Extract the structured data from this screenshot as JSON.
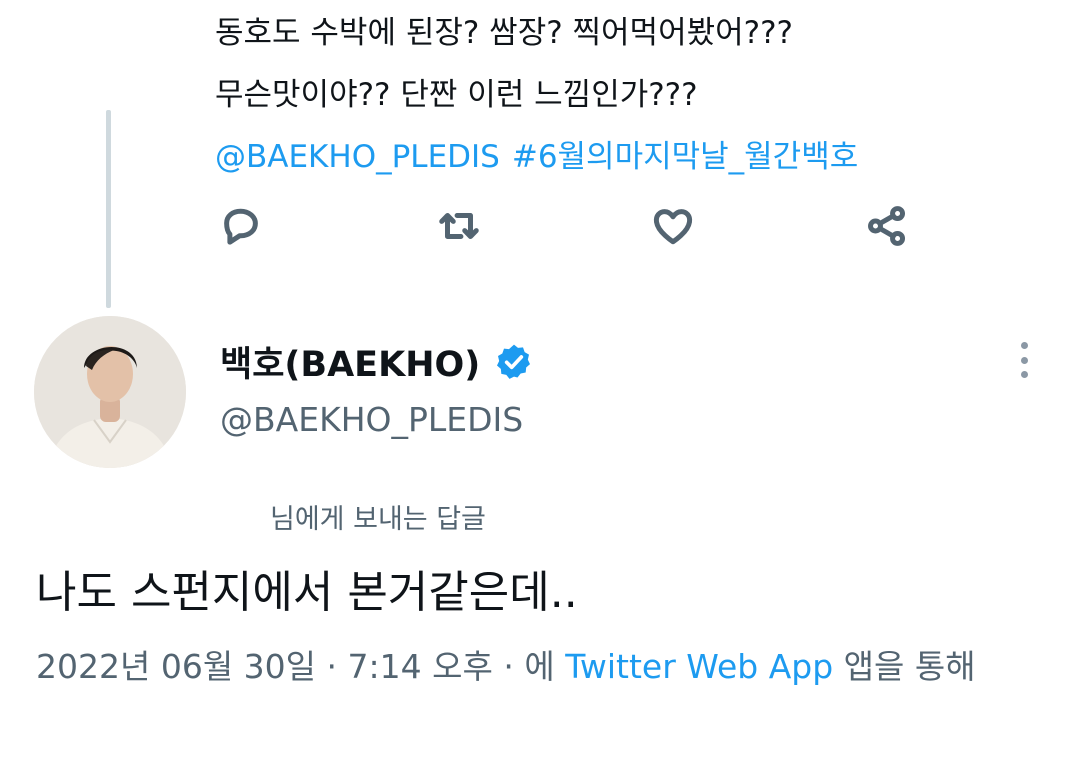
{
  "parent_tweet": {
    "lines": [
      "동호도 수박에 된장? 쌈장? 찍어먹어봤어???",
      "무슨맛이야?? 단짠 이런 느낌인가???"
    ],
    "mention": "@BAEKHO_PLEDIS",
    "hashtag": "#6월의마지막날_월간백호",
    "actions": {
      "reply": "reply-icon",
      "retweet": "retweet-icon",
      "like": "heart-icon",
      "share": "share-icon"
    }
  },
  "tweet": {
    "author_name": "백호(BAEKHO)",
    "author_handle": "@BAEKHO_PLEDIS",
    "verified": true,
    "replying_to": "님에게 보내는 답글",
    "text": "나도 스펀지에서 본거같은데..",
    "date": "2022년 06월 30일",
    "sep1": " · ",
    "time": "7:14 오후",
    "sep2": " · ",
    "via_prefix": "에 ",
    "source": "Twitter Web App",
    "via_suffix": " 앱을 통해"
  },
  "colors": {
    "accent": "#1d9bf0",
    "text_primary": "#0f1419",
    "text_secondary": "#536471",
    "thread_line": "#cfd9de"
  }
}
